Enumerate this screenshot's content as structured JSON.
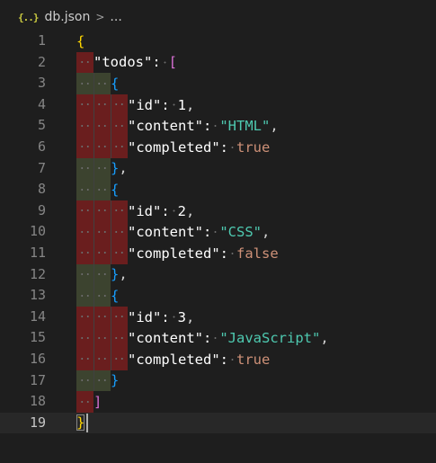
{
  "breadcrumb": {
    "icon": "{..}",
    "file": "db.json",
    "separator": ">",
    "more": "..."
  },
  "editor": {
    "language": "json",
    "current_line": 19,
    "lines": [
      {
        "num": "1",
        "text": "{"
      },
      {
        "num": "2",
        "text": "\"todos\": ["
      },
      {
        "num": "3",
        "text": "{"
      },
      {
        "num": "4",
        "text": "\"id\": 1,"
      },
      {
        "num": "5",
        "text": "\"content\": \"HTML\","
      },
      {
        "num": "6",
        "text": "\"completed\": true"
      },
      {
        "num": "7",
        "text": "},"
      },
      {
        "num": "8",
        "text": "{"
      },
      {
        "num": "9",
        "text": "\"id\": 2,"
      },
      {
        "num": "10",
        "text": "\"content\": \"CSS\","
      },
      {
        "num": "11",
        "text": "\"completed\": false"
      },
      {
        "num": "12",
        "text": "},"
      },
      {
        "num": "13",
        "text": "{"
      },
      {
        "num": "14",
        "text": "\"id\": 3,"
      },
      {
        "num": "15",
        "text": "\"content\": \"JavaScript\","
      },
      {
        "num": "16",
        "text": "\"completed\": true"
      },
      {
        "num": "17",
        "text": "}"
      },
      {
        "num": "18",
        "text": "]"
      },
      {
        "num": "19",
        "text": "}"
      }
    ]
  },
  "colors": {
    "background": "#1e1e1e",
    "key": "#ffffff",
    "string_value": "#4ec9b0",
    "literal": "#ce9178",
    "bracket_level_1": "#ffd700",
    "bracket_level_2": "#da70d6",
    "bracket_level_3": "#179fff",
    "indent_error": "#781e1e",
    "indent_ok": "#3e4630"
  }
}
